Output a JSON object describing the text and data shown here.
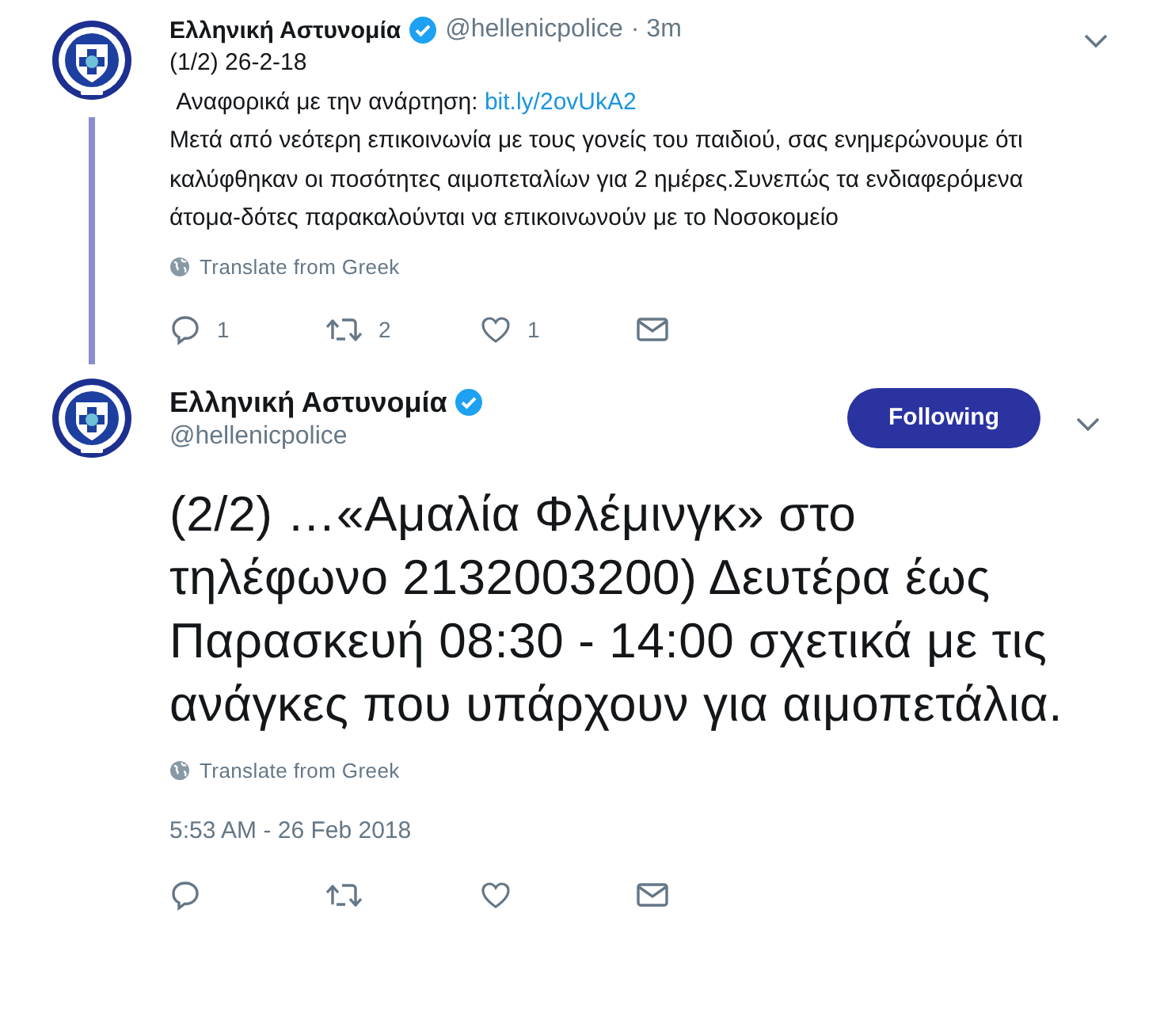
{
  "tweets": [
    {
      "name": "Ελληνική Αστυνομία",
      "verified": true,
      "handle": "@hellenicpolice",
      "time": "· 3m",
      "thread_line": true,
      "paragraphs": [
        {
          "text": "(1/2) 26-2-18"
        },
        {
          "text": " Αναφορικά με την ανάρτηση: ",
          "link": "bit.ly/2ovUkA2"
        },
        {
          "text": "Μετά από νεότερη επικοινωνία με τους γονείς του παιδιού, σας ενημερώνουμε ότι καλύφθηκαν οι ποσότητες αιμοπεταλίων για 2 ημέρες.Συνεπώς τα ενδιαφερόμενα άτομα-δότες παρακαλούνται να επικοινωνούν με το Νοσοκομείο"
        }
      ],
      "translate": "Translate from Greek",
      "actions": [
        {
          "kind": "reply",
          "count": "1"
        },
        {
          "kind": "retweet",
          "count": "2"
        },
        {
          "kind": "like",
          "count": "1"
        },
        {
          "kind": "message"
        }
      ]
    },
    {
      "name": "Ελληνική Αστυνομία",
      "verified": true,
      "handle": "@hellenicpolice",
      "follow_button": {
        "label": "Following",
        "following": true
      },
      "big_text": "(2/2) …«Αμαλία Φλέμινγκ» στο τηλέφωνο 2132003200) Δευτέρα έως Παρασκευή 08:30 - 14:00 σχετικά με τις ανάγκες που υπάρχουν για αιμοπετάλια.",
      "translate": "Translate from Greek",
      "timestamp": "5:53 AM - 26 Feb 2018",
      "actions": [
        {
          "kind": "reply"
        },
        {
          "kind": "retweet"
        },
        {
          "kind": "like"
        },
        {
          "kind": "message"
        }
      ]
    }
  ]
}
